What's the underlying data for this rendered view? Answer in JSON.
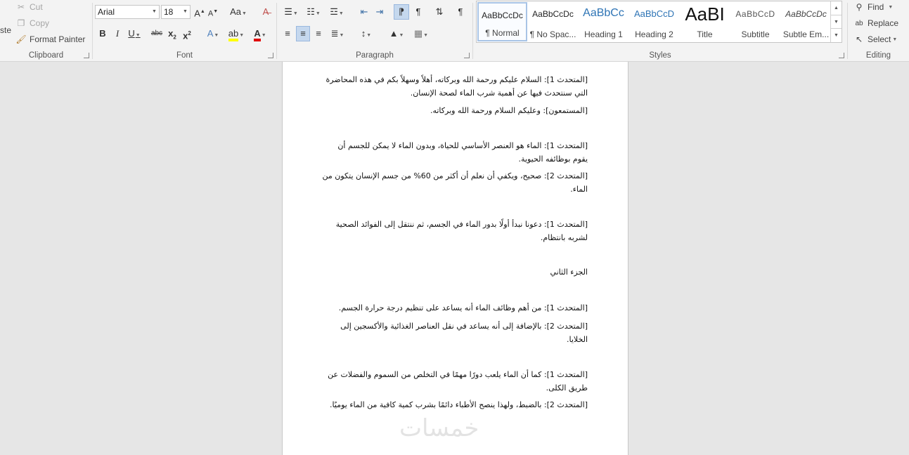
{
  "ribbon": {
    "clipboard": {
      "label": "Clipboard",
      "paste_fragment": "ste",
      "cut": "Cut",
      "copy": "Copy",
      "format_painter": "Format Painter"
    },
    "font": {
      "label": "Font",
      "family": "Arial",
      "size": "18"
    },
    "paragraph": {
      "label": "Paragraph"
    },
    "styles": {
      "label": "Styles",
      "items": [
        {
          "preview": "AaBbCcDc",
          "name": "¶ Normal"
        },
        {
          "preview": "AaBbCcDc",
          "name": "¶ No Spac..."
        },
        {
          "preview": "AaBbCc",
          "name": "Heading 1"
        },
        {
          "preview": "AaBbCcD",
          "name": "Heading 2"
        },
        {
          "preview": "AaBI",
          "name": "Title"
        },
        {
          "preview": "AaBbCcD",
          "name": "Subtitle"
        },
        {
          "preview": "AaBbCcDc",
          "name": "Subtle Em..."
        }
      ]
    },
    "editing": {
      "label": "Editing",
      "find": "Find",
      "replace": "Replace",
      "select": "Select"
    }
  },
  "document": {
    "paragraphs": [
      "[المتحدث 1]: السلام عليكم ورحمة الله وبركاته، أهلاً وسهلاً بكم في هذه المحاضرة التي سنتحدث فيها عن أهمية شرب الماء لصحة الإنسان.",
      "[المستمعون]: وعليكم السلام ورحمة الله وبركاته.",
      "[المتحدث 1]: الماء هو العنصر الأساسي للحياة، وبدون الماء لا يمكن للجسم أن يقوم بوظائفه الحيوية.",
      "[المتحدث 2]: صحيح، ويكفي أن نعلم أن أكثر من 60% من جسم الإنسان يتكون من الماء.",
      "[المتحدث 1]: دعونا نبدأ أولًا بدور الماء في الجسم، ثم ننتقل إلى الفوائد الصحية لشربه بانتظام.",
      "الجزء الثاني",
      "[المتحدث 1]: من أهم وظائف الماء أنه يساعد على تنظيم درجة حرارة الجسم.",
      "[المتحدث 2]: بالإضافة إلى أنه يساعد في نقل العناصر الغذائية والأكسجين إلى الخلايا.",
      "[المتحدث 1]: كما أن الماء يلعب دورًا مهمًا في التخلص من السموم والفضلات عن طريق الكلى.",
      "[المتحدث 2]: بالضبط، ولهذا ينصح الأطباء دائمًا بشرب كمية كافية من الماء يوميًا."
    ]
  },
  "watermark": "خمسات"
}
